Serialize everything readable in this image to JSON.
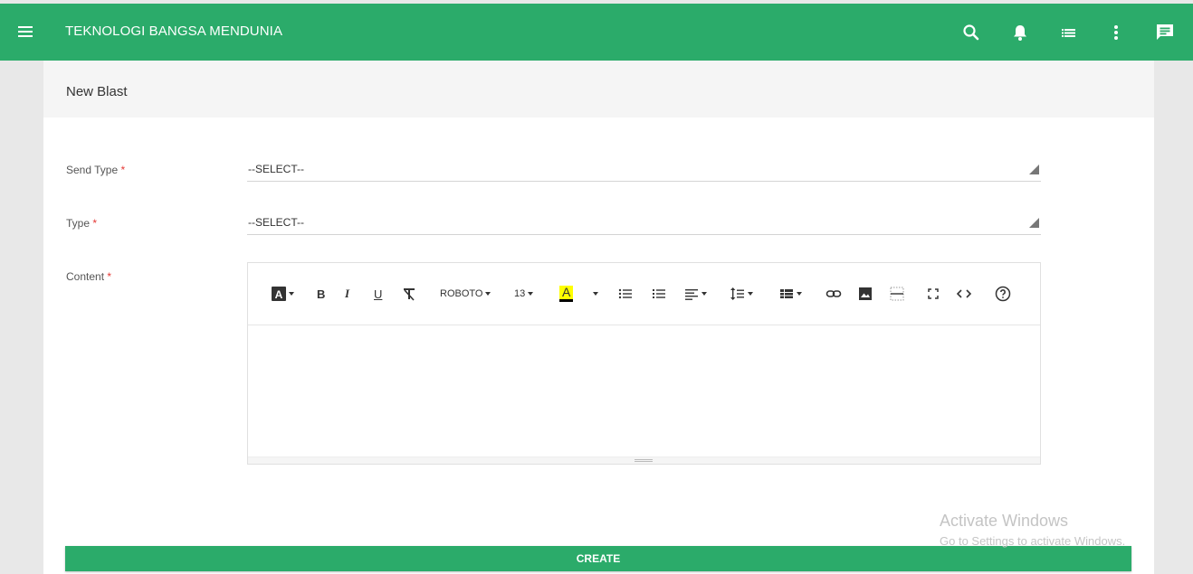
{
  "app": {
    "title": "TEKNOLOGI BANGSA MENDUNIA"
  },
  "topbar": {
    "icons": [
      "menu-icon",
      "search-icon",
      "bell-icon",
      "list-icon",
      "more-vert-icon",
      "chat-icon"
    ]
  },
  "colors": {
    "primary": "#2bab6a",
    "required": "#e53935",
    "highlight": "#ffff00"
  },
  "page": {
    "heading": "New Blast"
  },
  "form": {
    "send_type": {
      "label": "Send Type",
      "required_mark": "*",
      "value": "--SELECT--"
    },
    "type": {
      "label": "Type",
      "required_mark": "*",
      "value": "--SELECT--"
    },
    "content": {
      "label": "Content",
      "required_mark": "*"
    }
  },
  "editor": {
    "font_name": "ROBOTO",
    "font_size": "13",
    "highlight_letter": "A",
    "bold": "B",
    "italic": "I",
    "underline": "U",
    "value": ""
  },
  "actions": {
    "create_label": "CREATE"
  },
  "watermark": {
    "line1": "Activate Windows",
    "line2": "Go to Settings to activate Windows."
  }
}
